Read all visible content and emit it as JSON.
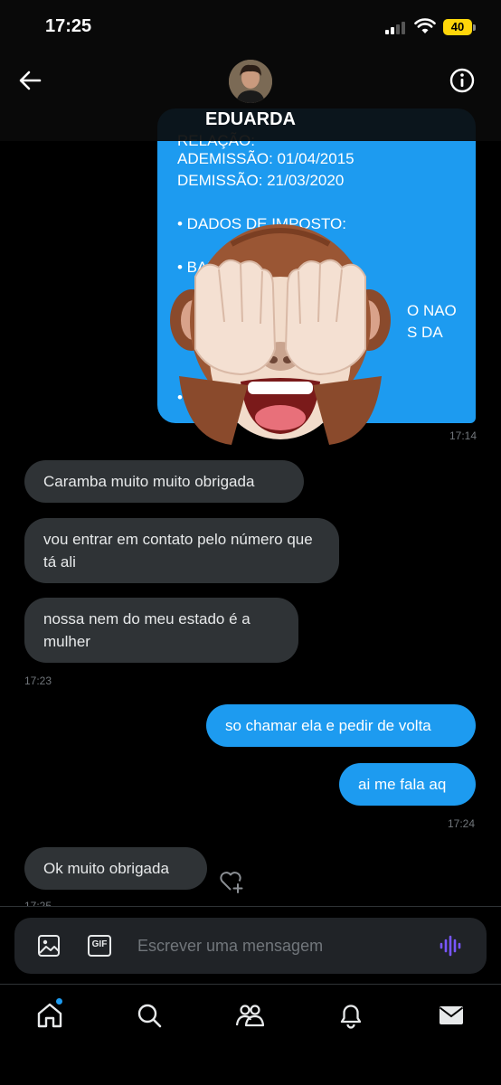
{
  "status_bar": {
    "time": "17:25",
    "battery": "40"
  },
  "header": {
    "contact_name": "EDUARDA"
  },
  "document_message": {
    "lines": [
      "RELAÇÃO:",
      "ADEMISSÃO: 01/04/2015",
      "DEMISSÃO: 21/03/2020",
      "• DADOS DE IMPOSTO:",
      "• BAN",
      "O NAO",
      "S DA",
      "•"
    ],
    "timestamp": "17:14",
    "overlay_sticker": "see-no-evil-monkey"
  },
  "messages": [
    {
      "direction": "in",
      "text": "Caramba muito muito obrigada"
    },
    {
      "direction": "in",
      "text": "vou entrar em contato pelo número que tá ali"
    },
    {
      "direction": "in",
      "text": "nossa nem do meu estado é a mulher",
      "timestamp": "17:23"
    },
    {
      "direction": "out",
      "text": "so chamar ela e pedir de volta"
    },
    {
      "direction": "out",
      "text": "ai me fala aq",
      "timestamp": "17:24"
    },
    {
      "direction": "in",
      "text": "Ok muito obrigada",
      "timestamp": "17:25"
    }
  ],
  "composer": {
    "placeholder": "Escrever uma mensagem",
    "gif_label": "GIF"
  },
  "tab_bar": {
    "items": [
      "home-icon",
      "search-icon",
      "communities-icon",
      "bell-icon",
      "mail-icon"
    ],
    "home_has_notification": true
  },
  "colors": {
    "accent": "#1d9bf0",
    "incoming_bubble": "#2f3336",
    "voice_icon": "#7856ff",
    "battery": "#ffd60a"
  }
}
